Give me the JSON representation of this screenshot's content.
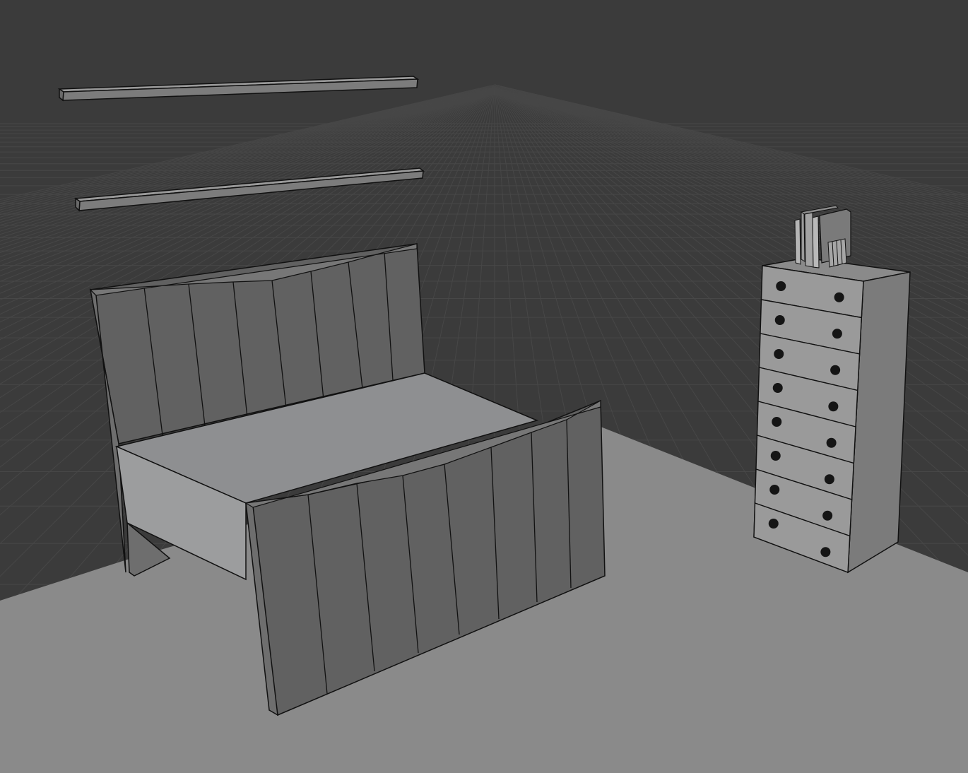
{
  "viewport": {
    "mode": "solid-shading",
    "objects": [
      "wall-shelf-upper",
      "wall-shelf-lower",
      "bed",
      "tall-dresser",
      "books"
    ]
  },
  "scene": {
    "colors": {
      "background": "#3b3b3b",
      "grid_line": "#4a4a4a",
      "floor": "#8a8a8a",
      "panel_dark": "#616161",
      "panel_mid": "#6e6e6e",
      "surface_light": "#8e8f91",
      "edge": "#111111",
      "knob": "#151515"
    },
    "dresser_drawer_count": 8,
    "headboard_slats": 8,
    "footboard_slats": 8
  }
}
